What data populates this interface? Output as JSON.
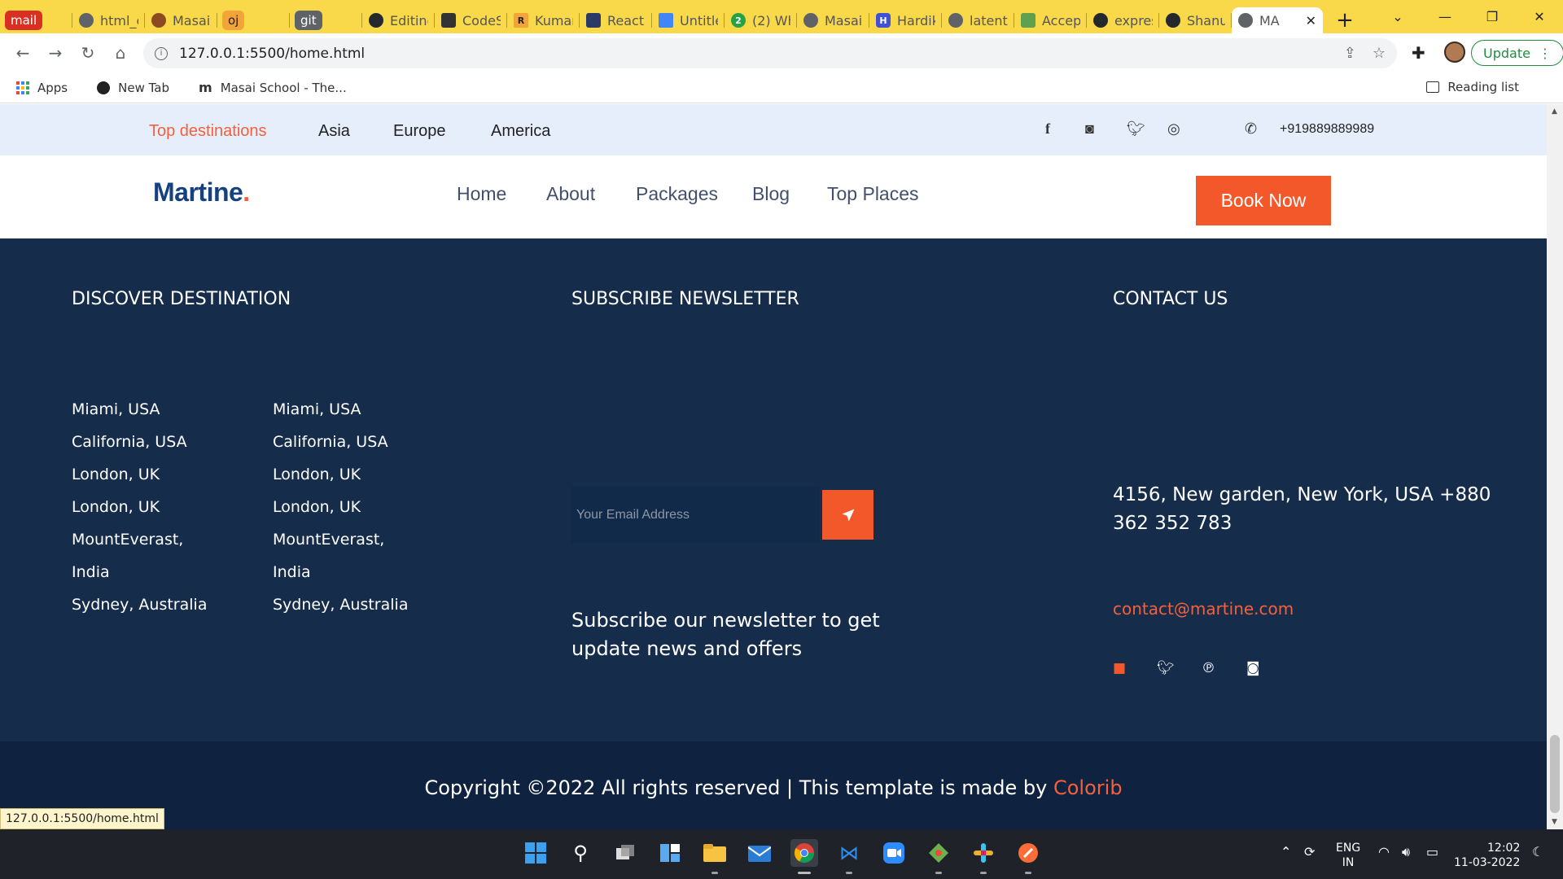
{
  "browser": {
    "tabs": [
      {
        "label": "mail",
        "type": "group",
        "color": "#d93025"
      },
      {
        "label": "html_c",
        "icon": "globe-icon"
      },
      {
        "label": "Masai",
        "icon": "pin-icon"
      },
      {
        "label": "oj",
        "type": "group",
        "color": "#f2a33a"
      },
      {
        "label": "git",
        "type": "group",
        "color": "#5f6368"
      },
      {
        "label": "Editing",
        "icon": "github-icon"
      },
      {
        "label": "CodeS",
        "icon": "codesandbox-icon"
      },
      {
        "label": "Kumar",
        "icon": "r-icon"
      },
      {
        "label": "React",
        "icon": "floppy-icon"
      },
      {
        "label": "Untitle",
        "icon": "docs-icon"
      },
      {
        "label": "(2) Wh",
        "icon": "whatsapp-icon"
      },
      {
        "label": "Masai",
        "icon": "globe-icon"
      },
      {
        "label": "Hardik",
        "icon": "h-icon"
      },
      {
        "label": "latent",
        "icon": "globe-icon"
      },
      {
        "label": "Accep",
        "icon": "node-icon"
      },
      {
        "label": "expres",
        "icon": "github-icon"
      },
      {
        "label": "Shanu",
        "icon": "github-icon"
      },
      {
        "label": "MA",
        "icon": "globe-icon",
        "active": true
      }
    ],
    "url": "127.0.0.1:5500/home.html",
    "update_label": "Update",
    "bookmarks": [
      "Apps",
      "New Tab",
      "Masai School - The..."
    ],
    "reading_list": "Reading list",
    "status_url": "127.0.0.1:5500/home.html"
  },
  "topbar": {
    "destinations": [
      "Top destinations",
      "Asia",
      "Europe",
      "America"
    ],
    "phone": "+919889889989",
    "social_icons": [
      "facebook-icon",
      "instagram-icon",
      "twitter-icon",
      "dribbble-icon"
    ]
  },
  "nav": {
    "logo": "Martine",
    "logo_dot": ".",
    "items": [
      "Home",
      "About",
      "Packages",
      "Blog",
      "Top Places"
    ],
    "book_now": "Book Now"
  },
  "footer": {
    "discover_title": "DISCOVER DESTINATION",
    "destinations_col1": [
      "Miami, USA",
      "California, USA",
      "London, UK",
      "London, UK",
      "MountEverast,",
      "India",
      "Sydney, Australia"
    ],
    "destinations_col2": [
      "Miami, USA",
      "California, USA",
      "London, UK",
      "London, UK",
      "MountEverast,",
      "India",
      "Sydney, Australia"
    ],
    "newsletter_title": "SUBSCRIBE NEWSLETTER",
    "email_placeholder": "Your Email Address",
    "newsletter_text": "Subscribe our newsletter to get update news and offers",
    "contact_title": "CONTACT US",
    "address": "4156, New garden, New York, USA +880 362 352 783",
    "email": "contact@martine.com",
    "copyright_text": "Copyright ©2022 All rights reserved | This template is made by ",
    "copyright_brand": "Colorib"
  },
  "taskbar": {
    "lang_top": "ENG",
    "lang_bottom": "IN",
    "time": "12:02",
    "date": "11-03-2022"
  },
  "colors": {
    "accent": "#f3582a",
    "footer_bg": "#162c4b",
    "topbar_bg": "#e6eefc",
    "logo": "#164181"
  }
}
